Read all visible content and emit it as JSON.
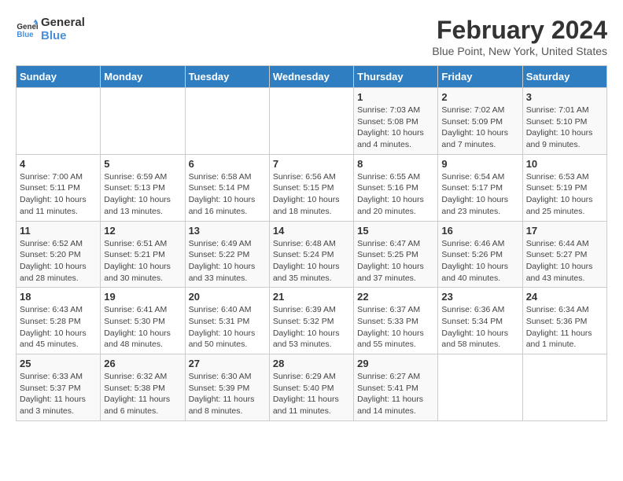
{
  "logo": {
    "text1": "General",
    "text2": "Blue"
  },
  "title": "February 2024",
  "subtitle": "Blue Point, New York, United States",
  "headers": [
    "Sunday",
    "Monday",
    "Tuesday",
    "Wednesday",
    "Thursday",
    "Friday",
    "Saturday"
  ],
  "weeks": [
    [
      {
        "num": "",
        "lines": []
      },
      {
        "num": "",
        "lines": []
      },
      {
        "num": "",
        "lines": []
      },
      {
        "num": "",
        "lines": []
      },
      {
        "num": "1",
        "lines": [
          "Sunrise: 7:03 AM",
          "Sunset: 5:08 PM",
          "Daylight: 10 hours",
          "and 4 minutes."
        ]
      },
      {
        "num": "2",
        "lines": [
          "Sunrise: 7:02 AM",
          "Sunset: 5:09 PM",
          "Daylight: 10 hours",
          "and 7 minutes."
        ]
      },
      {
        "num": "3",
        "lines": [
          "Sunrise: 7:01 AM",
          "Sunset: 5:10 PM",
          "Daylight: 10 hours",
          "and 9 minutes."
        ]
      }
    ],
    [
      {
        "num": "4",
        "lines": [
          "Sunrise: 7:00 AM",
          "Sunset: 5:11 PM",
          "Daylight: 10 hours",
          "and 11 minutes."
        ]
      },
      {
        "num": "5",
        "lines": [
          "Sunrise: 6:59 AM",
          "Sunset: 5:13 PM",
          "Daylight: 10 hours",
          "and 13 minutes."
        ]
      },
      {
        "num": "6",
        "lines": [
          "Sunrise: 6:58 AM",
          "Sunset: 5:14 PM",
          "Daylight: 10 hours",
          "and 16 minutes."
        ]
      },
      {
        "num": "7",
        "lines": [
          "Sunrise: 6:56 AM",
          "Sunset: 5:15 PM",
          "Daylight: 10 hours",
          "and 18 minutes."
        ]
      },
      {
        "num": "8",
        "lines": [
          "Sunrise: 6:55 AM",
          "Sunset: 5:16 PM",
          "Daylight: 10 hours",
          "and 20 minutes."
        ]
      },
      {
        "num": "9",
        "lines": [
          "Sunrise: 6:54 AM",
          "Sunset: 5:17 PM",
          "Daylight: 10 hours",
          "and 23 minutes."
        ]
      },
      {
        "num": "10",
        "lines": [
          "Sunrise: 6:53 AM",
          "Sunset: 5:19 PM",
          "Daylight: 10 hours",
          "and 25 minutes."
        ]
      }
    ],
    [
      {
        "num": "11",
        "lines": [
          "Sunrise: 6:52 AM",
          "Sunset: 5:20 PM",
          "Daylight: 10 hours",
          "and 28 minutes."
        ]
      },
      {
        "num": "12",
        "lines": [
          "Sunrise: 6:51 AM",
          "Sunset: 5:21 PM",
          "Daylight: 10 hours",
          "and 30 minutes."
        ]
      },
      {
        "num": "13",
        "lines": [
          "Sunrise: 6:49 AM",
          "Sunset: 5:22 PM",
          "Daylight: 10 hours",
          "and 33 minutes."
        ]
      },
      {
        "num": "14",
        "lines": [
          "Sunrise: 6:48 AM",
          "Sunset: 5:24 PM",
          "Daylight: 10 hours",
          "and 35 minutes."
        ]
      },
      {
        "num": "15",
        "lines": [
          "Sunrise: 6:47 AM",
          "Sunset: 5:25 PM",
          "Daylight: 10 hours",
          "and 37 minutes."
        ]
      },
      {
        "num": "16",
        "lines": [
          "Sunrise: 6:46 AM",
          "Sunset: 5:26 PM",
          "Daylight: 10 hours",
          "and 40 minutes."
        ]
      },
      {
        "num": "17",
        "lines": [
          "Sunrise: 6:44 AM",
          "Sunset: 5:27 PM",
          "Daylight: 10 hours",
          "and 43 minutes."
        ]
      }
    ],
    [
      {
        "num": "18",
        "lines": [
          "Sunrise: 6:43 AM",
          "Sunset: 5:28 PM",
          "Daylight: 10 hours",
          "and 45 minutes."
        ]
      },
      {
        "num": "19",
        "lines": [
          "Sunrise: 6:41 AM",
          "Sunset: 5:30 PM",
          "Daylight: 10 hours",
          "and 48 minutes."
        ]
      },
      {
        "num": "20",
        "lines": [
          "Sunrise: 6:40 AM",
          "Sunset: 5:31 PM",
          "Daylight: 10 hours",
          "and 50 minutes."
        ]
      },
      {
        "num": "21",
        "lines": [
          "Sunrise: 6:39 AM",
          "Sunset: 5:32 PM",
          "Daylight: 10 hours",
          "and 53 minutes."
        ]
      },
      {
        "num": "22",
        "lines": [
          "Sunrise: 6:37 AM",
          "Sunset: 5:33 PM",
          "Daylight: 10 hours",
          "and 55 minutes."
        ]
      },
      {
        "num": "23",
        "lines": [
          "Sunrise: 6:36 AM",
          "Sunset: 5:34 PM",
          "Daylight: 10 hours",
          "and 58 minutes."
        ]
      },
      {
        "num": "24",
        "lines": [
          "Sunrise: 6:34 AM",
          "Sunset: 5:36 PM",
          "Daylight: 11 hours",
          "and 1 minute."
        ]
      }
    ],
    [
      {
        "num": "25",
        "lines": [
          "Sunrise: 6:33 AM",
          "Sunset: 5:37 PM",
          "Daylight: 11 hours",
          "and 3 minutes."
        ]
      },
      {
        "num": "26",
        "lines": [
          "Sunrise: 6:32 AM",
          "Sunset: 5:38 PM",
          "Daylight: 11 hours",
          "and 6 minutes."
        ]
      },
      {
        "num": "27",
        "lines": [
          "Sunrise: 6:30 AM",
          "Sunset: 5:39 PM",
          "Daylight: 11 hours",
          "and 8 minutes."
        ]
      },
      {
        "num": "28",
        "lines": [
          "Sunrise: 6:29 AM",
          "Sunset: 5:40 PM",
          "Daylight: 11 hours",
          "and 11 minutes."
        ]
      },
      {
        "num": "29",
        "lines": [
          "Sunrise: 6:27 AM",
          "Sunset: 5:41 PM",
          "Daylight: 11 hours",
          "and 14 minutes."
        ]
      },
      {
        "num": "",
        "lines": []
      },
      {
        "num": "",
        "lines": []
      }
    ]
  ]
}
